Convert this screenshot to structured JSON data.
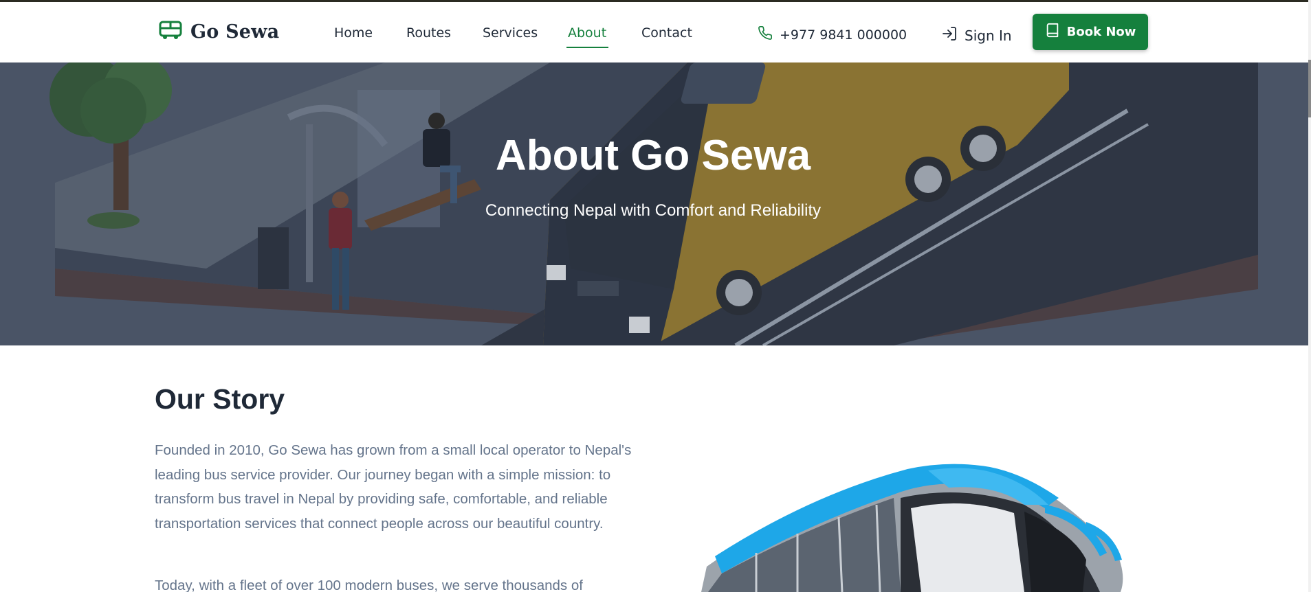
{
  "brand": {
    "name": "Go Sewa",
    "color": "#15803d",
    "icon": "bus-icon"
  },
  "nav": {
    "items": [
      {
        "label": "Home",
        "active": false
      },
      {
        "label": "Routes",
        "active": false
      },
      {
        "label": "Services",
        "active": false
      },
      {
        "label": "About",
        "active": true
      },
      {
        "label": "Contact",
        "active": false
      }
    ]
  },
  "header": {
    "phone": "+977 9841 000000",
    "phone_icon": "phone-icon",
    "signin_label": "Sign In",
    "signin_icon": "sign-in-icon",
    "book_label": "Book Now",
    "book_icon": "book-icon"
  },
  "hero": {
    "title": "About Go Sewa",
    "subtitle": "Connecting Nepal with Comfort and Reliability"
  },
  "story": {
    "title": "Our Story",
    "paragraphs": [
      "Founded in 2010, Go Sewa has grown from a small local operator to Nepal's leading bus service provider. Our journey began with a simple mission: to transform bus travel in Nepal by providing safe, comfortable, and reliable transportation services that connect people across our beautiful country.",
      "Today, with a fleet of over 100 modern buses, we serve thousands of"
    ]
  }
}
